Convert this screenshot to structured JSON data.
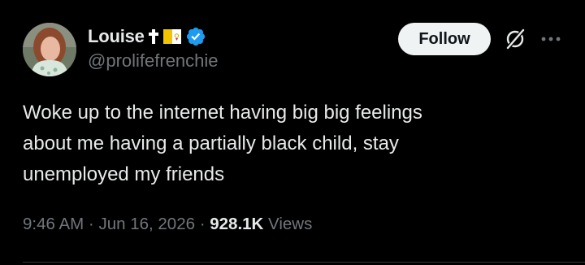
{
  "tweet": {
    "author": {
      "display_name": "Louise",
      "handle": "@prolifefrenchie",
      "verified": true,
      "name_emojis": [
        "latin-cross-emoji",
        "vatican-flag-emoji"
      ]
    },
    "follow_label": "Follow",
    "text": "Woke up to the internet having big big feelings\nabout me having a partially black child, stay\nunemployed my friends",
    "time": "9:46 AM",
    "separator": "·",
    "date": "Jun 16, 2026",
    "views_count": "928.1K",
    "views_label": "Views"
  },
  "colors": {
    "background": "#000000",
    "primary_text": "#e7e9ea",
    "secondary_text": "#71767b",
    "verified_badge": "#1d9bf0",
    "follow_button_bg": "#eff3f4",
    "follow_button_text": "#0f1419",
    "divider": "#2f3336"
  },
  "icons": {
    "verified": "verified-badge-icon",
    "grok": "grok-icon",
    "more": "more-options-icon"
  }
}
